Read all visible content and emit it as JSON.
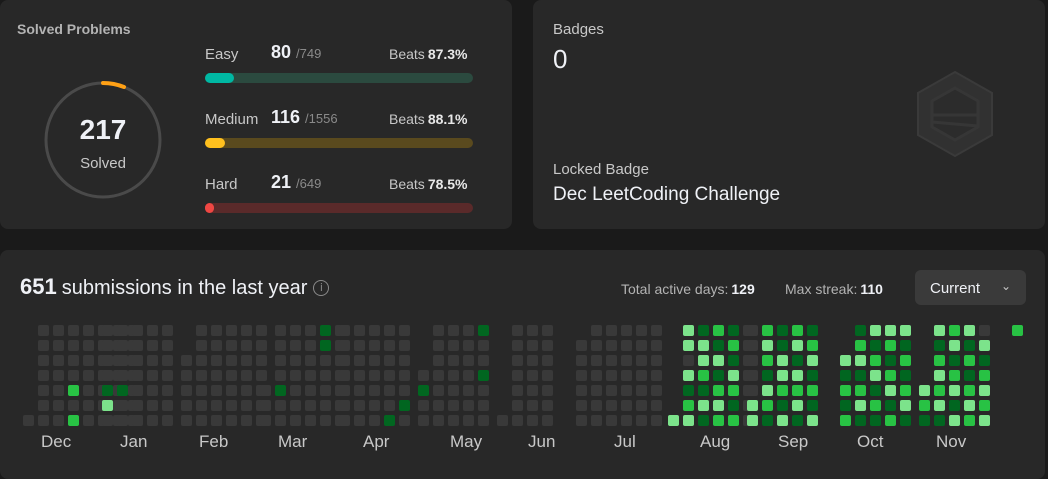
{
  "solved": {
    "title": "Solved Problems",
    "total": "217",
    "subtitle": "Solved",
    "ring_progress": 0.06,
    "difficulties": [
      {
        "label": "Easy",
        "count": "80",
        "total": "/749",
        "beats_label": "Beats",
        "beats": "87.3%",
        "fraction": 0.107,
        "color": "#00b8a3",
        "track": "#2b4a3f"
      },
      {
        "label": "Medium",
        "count": "116",
        "total": "/1556",
        "beats_label": "Beats",
        "beats": "88.1%",
        "fraction": 0.075,
        "color": "#ffc01e",
        "track": "#5a4a1e"
      },
      {
        "label": "Hard",
        "count": "21",
        "total": "/649",
        "beats_label": "Beats",
        "beats": "78.5%",
        "fraction": 0.032,
        "color": "#ef4743",
        "track": "#5a2a2a"
      }
    ]
  },
  "badges": {
    "label": "Badges",
    "count": "0",
    "locked_label": "Locked Badge",
    "locked_name": "Dec LeetCoding Challenge",
    "icon": "hexagon-badge-icon"
  },
  "submissions": {
    "count": "651",
    "text": "submissions in the last year",
    "info_icon": "info-icon",
    "active_days_label": "Total active days:",
    "active_days": "129",
    "max_streak_label": "Max streak:",
    "max_streak": "110",
    "dropdown_value": "Current",
    "months": [
      "Dec",
      "Jan",
      "Feb",
      "Mar",
      "Apr",
      "May",
      "Jun",
      "Jul",
      "Aug",
      "Sep",
      "Oct",
      "Nov"
    ],
    "colors": {
      "empty": "#393939",
      "l1": "#016620",
      "l2": "#28c244",
      "l3": "#7ce38b"
    }
  }
}
